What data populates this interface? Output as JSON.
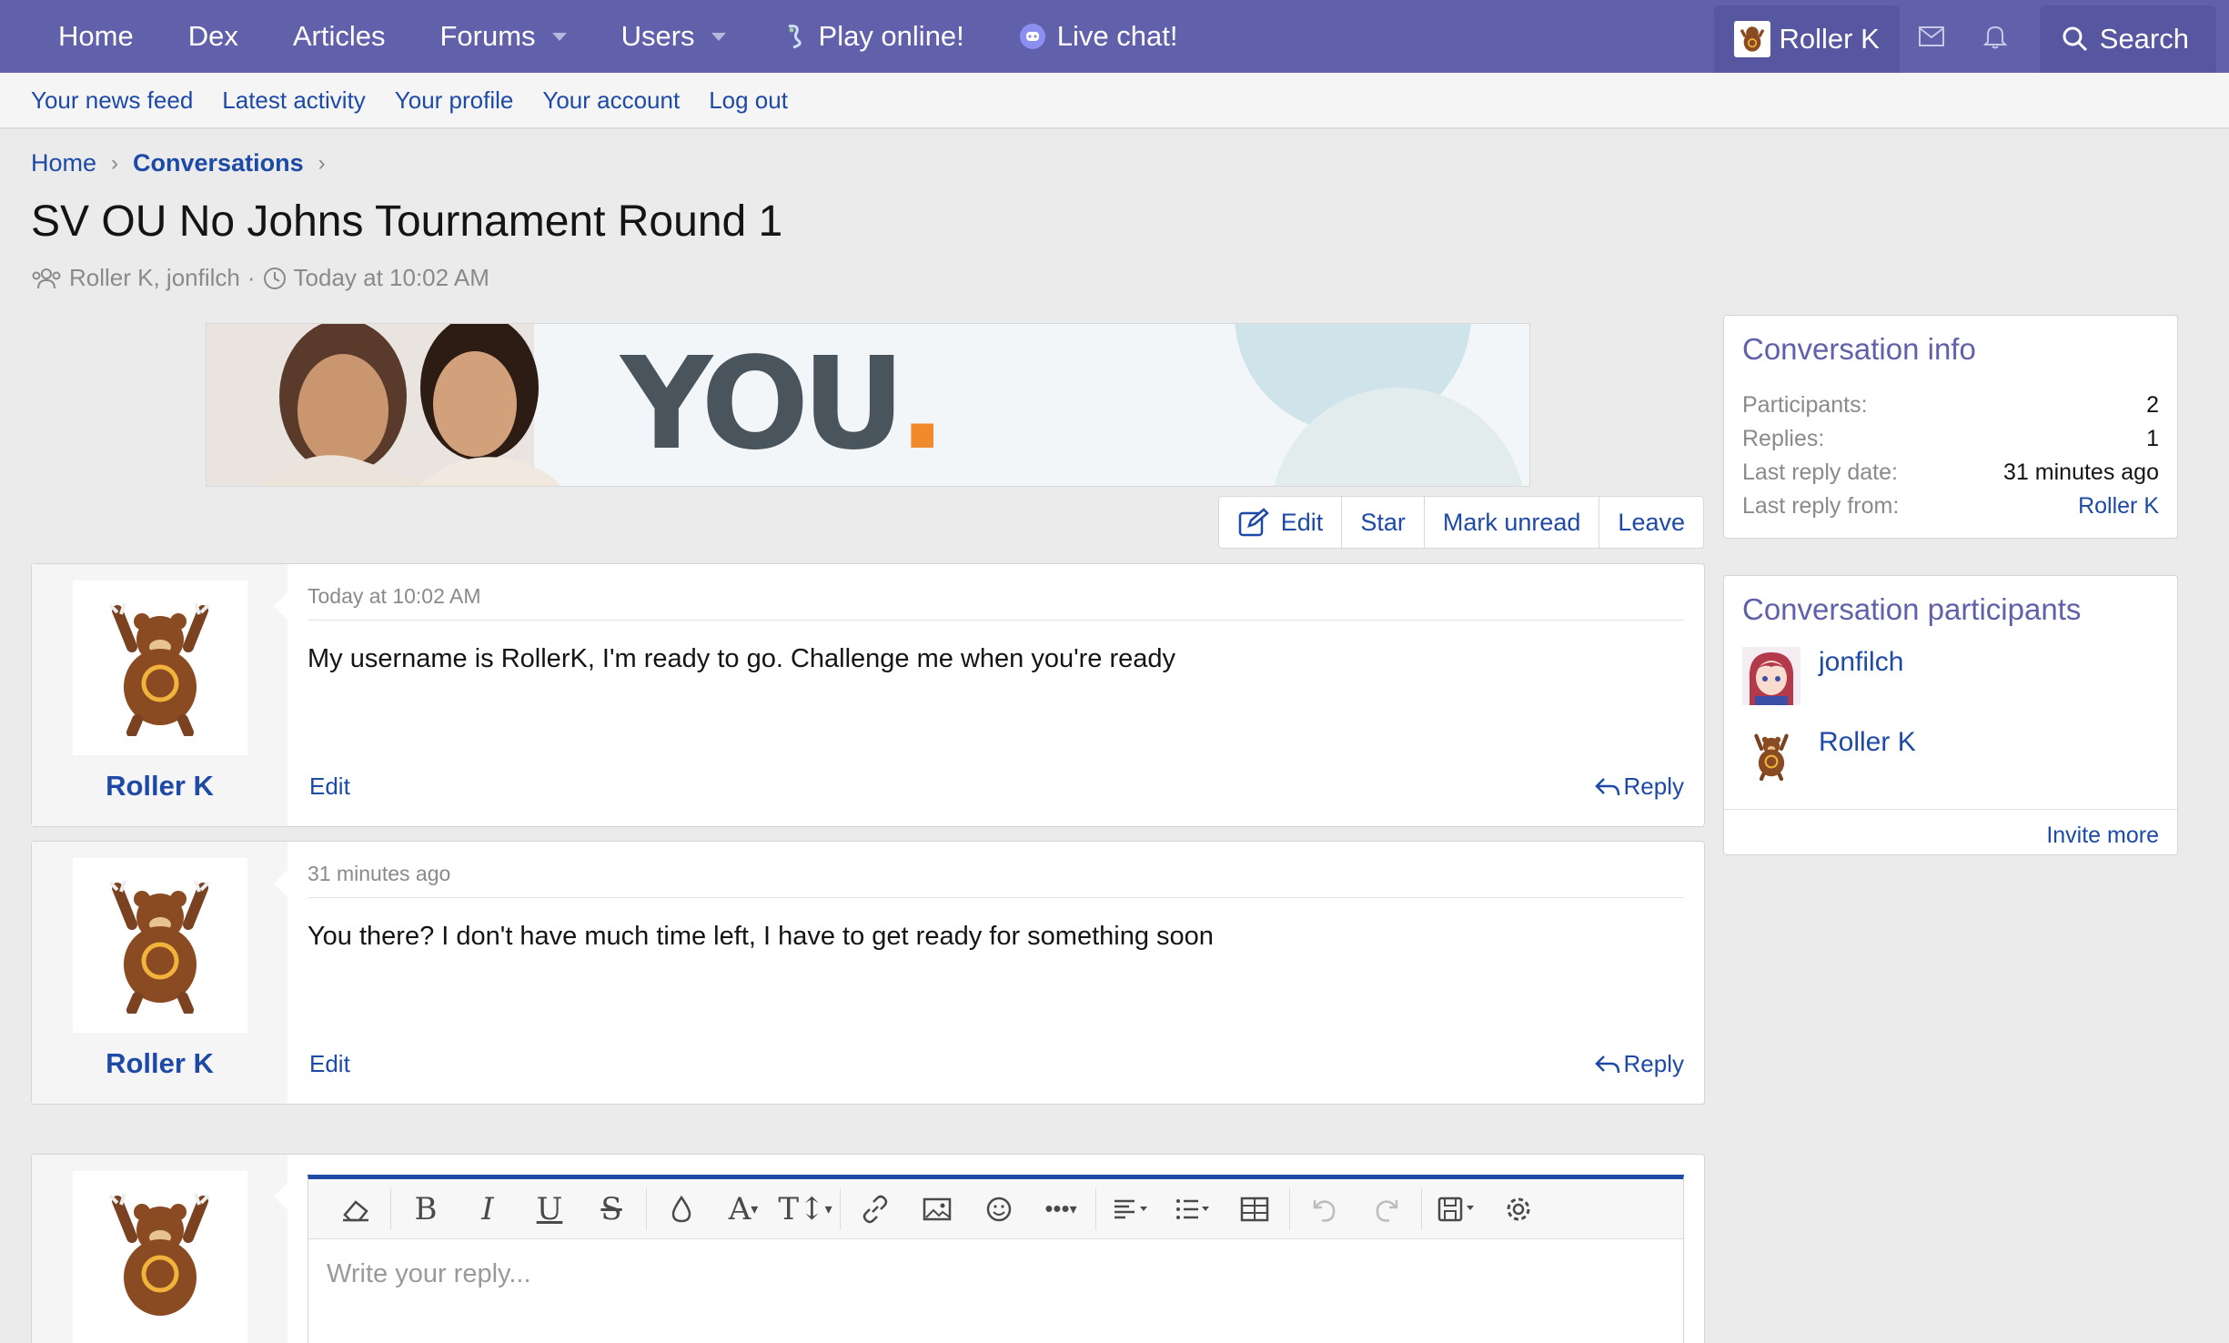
{
  "nav": {
    "items": [
      {
        "label": "Home",
        "has_caret": false
      },
      {
        "label": "Dex",
        "has_caret": false
      },
      {
        "label": "Articles",
        "has_caret": false
      },
      {
        "label": "Forums",
        "has_caret": true
      },
      {
        "label": "Users",
        "has_caret": true
      }
    ],
    "play_label": "Play online!",
    "chat_label": "Live chat!",
    "user_name": "Roller K",
    "search_label": "Search"
  },
  "subnav": {
    "items": [
      "Your news feed",
      "Latest activity",
      "Your profile",
      "Your account",
      "Log out"
    ]
  },
  "breadcrumb": {
    "home": "Home",
    "current": "Conversations"
  },
  "page": {
    "title": "SV OU No Johns Tournament Round 1",
    "participants_text": "Roller K, jonfilch",
    "meta_sep": "·",
    "time": "Today at 10:02 AM"
  },
  "banner": {
    "text": "YOU",
    "dot": "."
  },
  "actions": {
    "edit": "Edit",
    "star": "Star",
    "mark_unread": "Mark unread",
    "leave": "Leave"
  },
  "messages": [
    {
      "user": "Roller K",
      "time": "Today at 10:02 AM",
      "text": "My username is RollerK, I'm ready to go. Challenge me when you're ready",
      "edit": "Edit",
      "reply": "Reply"
    },
    {
      "user": "Roller K",
      "time": "31 minutes ago",
      "text": "You there? I don't have much time left, I have to get ready for something soon",
      "edit": "Edit",
      "reply": "Reply"
    }
  ],
  "editor": {
    "placeholder": "Write your reply..."
  },
  "info": {
    "title": "Conversation info",
    "rows": [
      {
        "k": "Participants:",
        "v": "2"
      },
      {
        "k": "Replies:",
        "v": "1"
      },
      {
        "k": "Last reply date:",
        "v": "31 minutes ago"
      },
      {
        "k": "Last reply from:",
        "v": "Roller K"
      }
    ]
  },
  "participants": {
    "title": "Conversation participants",
    "list": [
      "jonfilch",
      "Roller K"
    ],
    "invite": "Invite more"
  },
  "colors": {
    "nav": "#6160ab",
    "link": "#1d49a7",
    "accent_orange": "#f08a2c"
  }
}
